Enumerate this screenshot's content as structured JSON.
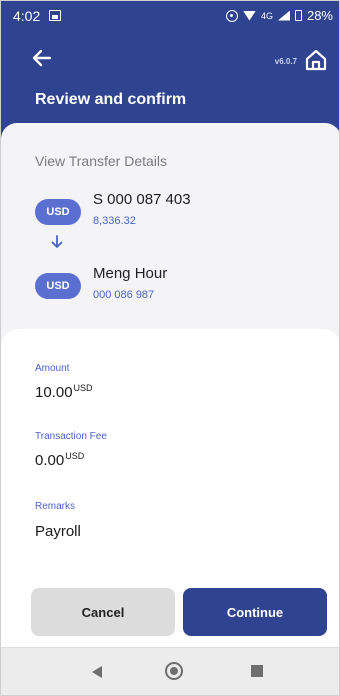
{
  "status_bar": {
    "time": "4:02",
    "network": "4G",
    "battery": "28%",
    "icons": [
      "image-icon",
      "vibrate-icon",
      "wifi-icon",
      "signal-icon",
      "battery-icon"
    ]
  },
  "header": {
    "version": "v6.0.7",
    "title": "Review and confirm",
    "color": "#2f4390"
  },
  "details": {
    "heading": "View Transfer Details",
    "from": {
      "currency": "USD",
      "name": "S 000 087 403",
      "sub": "8,336.32"
    },
    "to": {
      "currency": "USD",
      "name": "Meng Hour",
      "sub": "000 086 987"
    }
  },
  "form": {
    "amount": {
      "label": "Amount",
      "value": "10.00",
      "currency": "USD"
    },
    "fee": {
      "label": "Transaction Fee",
      "value": "0.00",
      "currency": "USD"
    },
    "remarks": {
      "label": "Remarks",
      "value": "Payroll"
    }
  },
  "actions": {
    "cancel": "Cancel",
    "continue": "Continue"
  },
  "colors": {
    "primary": "#2f4390",
    "pill": "#5a6fd0",
    "accent_text": "#4b63c8"
  }
}
